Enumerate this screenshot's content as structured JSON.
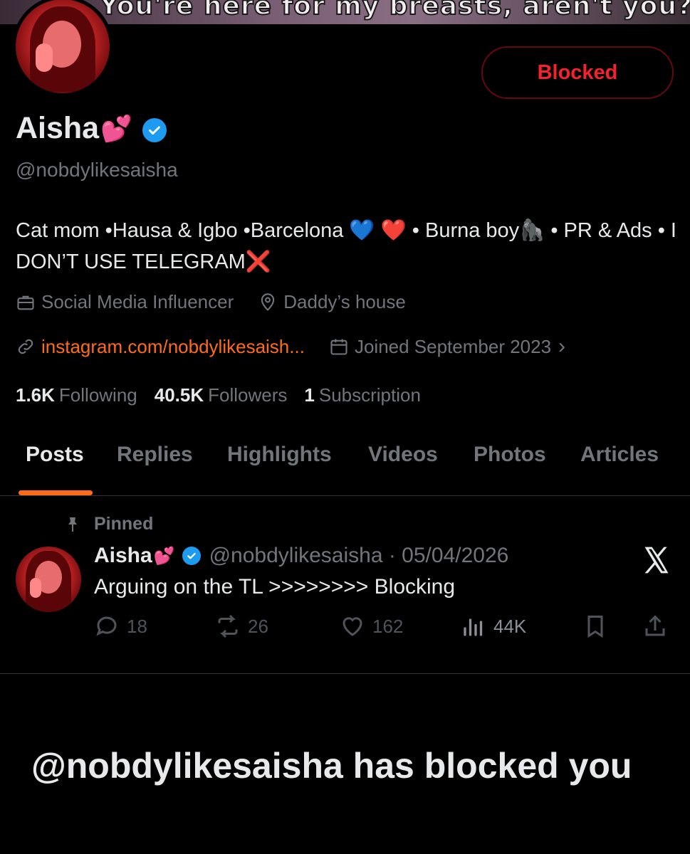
{
  "banner": {
    "caption": "You're here for my breasts, aren't you?"
  },
  "profile": {
    "name": "Aisha",
    "name_emoji": "💕",
    "handle": "@nobdylikesaisha",
    "blocked_button": "Blocked",
    "bio": {
      "part1": "Cat mom •Hausa & Igbo •Barcelona ",
      "heart_blue": "💙",
      "heart_red": "❤️",
      "part2": " • Burna boy",
      "gorilla": "🦍",
      "part3": " • PR & Ads • I DON’T USE TELEGRAM",
      "cross": "❌"
    },
    "category": "Social Media Influencer",
    "location": "Daddy’s house",
    "link": "instagram.com/nobdylikesaish...",
    "joined": "Joined September 2023",
    "joined_chevron": "›",
    "following_count": "1.6K",
    "following_label": "Following",
    "followers_count": "40.5K",
    "followers_label": "Followers",
    "subscription_count": "1",
    "subscription_label": "Subscription"
  },
  "tabs": [
    "Posts",
    "Replies",
    "Highlights",
    "Videos",
    "Photos",
    "Articles"
  ],
  "post": {
    "pinned_label": "Pinned",
    "author_name": "Aisha",
    "author_emoji": "💕",
    "author_handle": "@nobdylikesaisha · 05/04/2026",
    "text": "Arguing on the TL >>>>>>>> Blocking",
    "replies": "18",
    "reposts": "26",
    "likes": "162",
    "views": "44K"
  },
  "blocked_notice": "@nobdylikesaisha has blocked you",
  "colors": {
    "accent": "#ff6b1a",
    "blocked_red": "#f4212e",
    "verified_blue": "#1d9bf0",
    "muted": "#71767b",
    "background": "#000000"
  },
  "icons": [
    "briefcase-icon",
    "location-pin-icon",
    "link-icon",
    "calendar-icon",
    "pin-icon",
    "x-logo-icon",
    "reply-icon",
    "repost-icon",
    "like-icon",
    "views-icon",
    "bookmark-icon",
    "share-icon",
    "verified-badge-icon"
  ]
}
